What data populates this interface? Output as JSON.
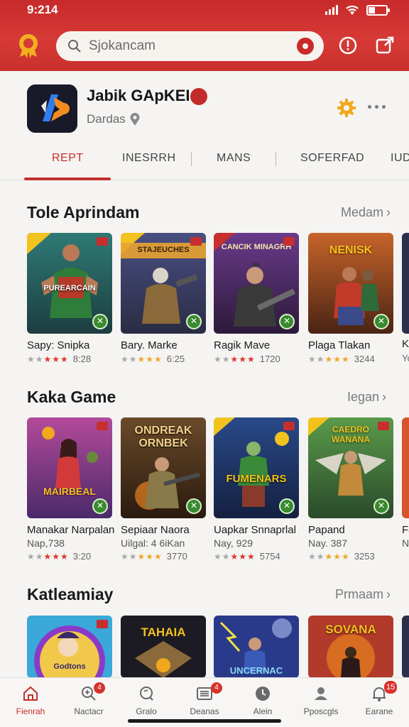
{
  "status_bar": {
    "time": "9:214"
  },
  "search": {
    "placeholder": "Sjokancam"
  },
  "profile": {
    "app_name": "Jabik GApKEI",
    "subtitle": "Dardas"
  },
  "tabs": [
    {
      "label": "REPT",
      "active": true
    },
    {
      "label": "INESRRH"
    },
    {
      "label": "MANS"
    },
    {
      "label": "SOFERFAD"
    },
    {
      "label": "IUD"
    }
  ],
  "sections": [
    {
      "title": "Tole Aprindam",
      "more": "Medam",
      "cards": [
        {
          "thumb_text": "PUREARCAIN",
          "title": "Sapy: Snipka",
          "rating": "8:28",
          "stars": [
            "g",
            "g",
            "r",
            "r",
            "r"
          ]
        },
        {
          "thumb_text": "STAJEUCHES",
          "title": "Bary. Marke",
          "rating": "6:25",
          "stars": [
            "g",
            "g",
            "y",
            "y",
            "y"
          ]
        },
        {
          "thumb_text": "CANCIK MINAGRH",
          "title": "Ragik Mave",
          "rating": "1720",
          "stars": [
            "g",
            "g",
            "r",
            "r",
            "r"
          ]
        },
        {
          "thumb_text": "NENISK",
          "title": "Plaga Tlakan",
          "rating": "3244",
          "stars": [
            "g",
            "g",
            "y",
            "y",
            "y"
          ]
        },
        {
          "title": "Ki",
          "rating": "Yo"
        }
      ]
    },
    {
      "title": "Kaka Game",
      "more": "Iegan",
      "cards": [
        {
          "thumb_text": "MAIRBEAL",
          "title": "Manakar Narpalan",
          "sub": "Nap,738",
          "rating": "3:20",
          "stars": [
            "g",
            "g",
            "r",
            "r",
            "r"
          ]
        },
        {
          "thumb_text": "ONDREAK ORNBEK",
          "title": "Sepiaar Naora",
          "sub": "Uilgal: 4 6iKan",
          "rating": "3770",
          "stars": [
            "g",
            "g",
            "y",
            "y",
            "y"
          ]
        },
        {
          "thumb_text": "FUMENARS",
          "title": "Uapkar Snnaprlal",
          "sub": "Nay, 929",
          "rating": "5754",
          "stars": [
            "g",
            "g",
            "r",
            "r",
            "r"
          ]
        },
        {
          "thumb_text": "CAEDRO WANANA",
          "title": "Papand",
          "sub": "Nay. 387",
          "rating": "3253",
          "stars": [
            "g",
            "g",
            "y",
            "y",
            "y"
          ]
        },
        {
          "title": "Fa",
          "sub": "Na"
        }
      ]
    },
    {
      "title": "Katleamiay",
      "more": "Prmaam",
      "cards": [
        {
          "thumb_text": "Godtons"
        },
        {
          "thumb_text": "TAHAIA"
        },
        {
          "thumb_text": "UNCERNAC"
        },
        {
          "thumb_text": "SOVANA"
        }
      ]
    }
  ],
  "bottom_nav": [
    {
      "label": "Fienrah",
      "icon": "home-icon",
      "active": true
    },
    {
      "label": "Nactacr",
      "icon": "search-plus-icon",
      "badge": "4"
    },
    {
      "label": "Gralo",
      "icon": "magnifier-icon"
    },
    {
      "label": "Deanas",
      "icon": "list-icon",
      "badge": "4"
    },
    {
      "label": "Alein",
      "icon": "clock-icon"
    },
    {
      "label": "Pposcgls",
      "icon": "user-icon"
    },
    {
      "label": "Earane",
      "icon": "bell-icon",
      "badge": "15"
    }
  ],
  "colors": {
    "brand_red": "#c72a2a",
    "accent_gold": "#f2b01e",
    "check_green": "#3a8a2f"
  }
}
